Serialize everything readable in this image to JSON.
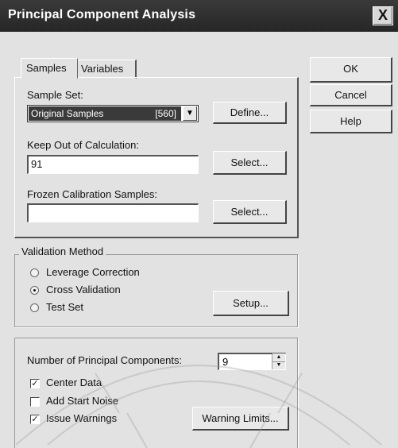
{
  "window": {
    "title": "Principal Component Analysis",
    "close_glyph": "X"
  },
  "tabs": [
    {
      "label": "Samples"
    },
    {
      "label": "Variables"
    }
  ],
  "samples": {
    "sample_set_label": "Sample Set:",
    "sample_set_value": "Original Samples",
    "sample_set_count": "[560]",
    "define_button": "Define...",
    "keep_out_label": "Keep Out of Calculation:",
    "keep_out_value": "91",
    "keep_out_select": "Select...",
    "frozen_label": "Frozen Calibration Samples:",
    "frozen_value": "",
    "frozen_select": "Select..."
  },
  "actions": {
    "ok": "OK",
    "cancel": "Cancel",
    "help": "Help"
  },
  "validation": {
    "title": "Validation Method",
    "options": [
      {
        "label": "Leverage Correction",
        "checked": false
      },
      {
        "label": "Cross Validation",
        "checked": true
      },
      {
        "label": "Test Set",
        "checked": false
      }
    ],
    "setup_button": "Setup..."
  },
  "components": {
    "num_pc_label": "Number of Principal Components:",
    "num_pc_value": "9",
    "center_data": {
      "label": "Center Data",
      "checked": true
    },
    "add_start_noise": {
      "label": "Add Start Noise",
      "checked": false
    },
    "issue_warnings": {
      "label": "Issue Warnings",
      "checked": true
    },
    "warning_limits_button": "Warning Limits..."
  }
}
